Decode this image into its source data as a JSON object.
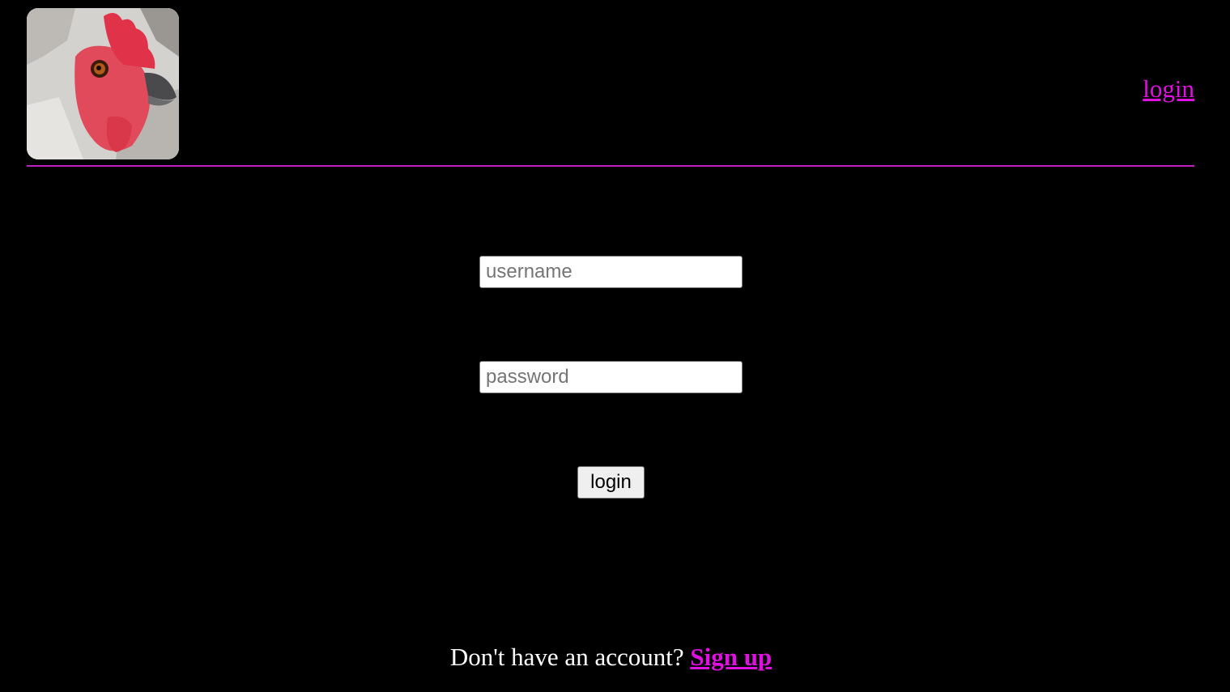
{
  "header": {
    "logo_icon": "chicken-head-logo",
    "nav_login_label": "login"
  },
  "form": {
    "username_placeholder": "username",
    "password_placeholder": "password",
    "submit_label": "login"
  },
  "footer": {
    "prompt": "Don't have an account?",
    "signup_label": "Sign up"
  },
  "colors": {
    "background": "#000000",
    "accent": "#e010e0",
    "text": "#ffffff"
  }
}
